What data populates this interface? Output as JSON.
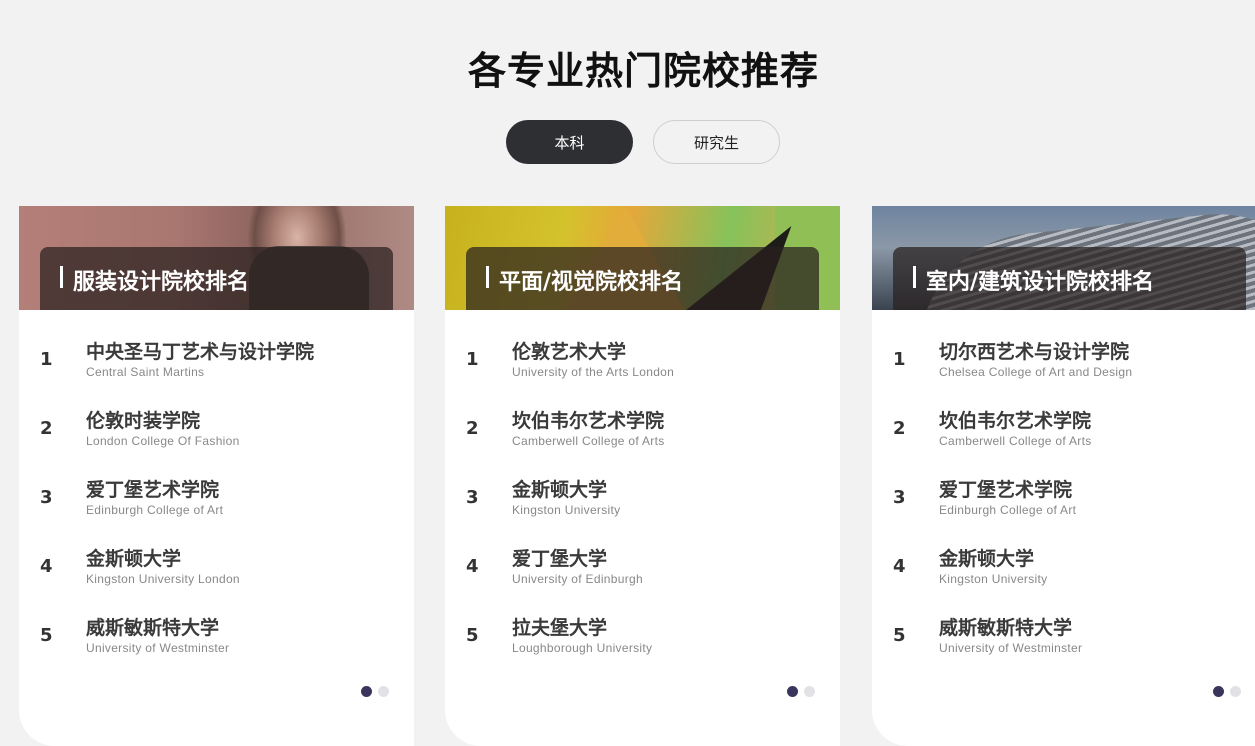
{
  "page_title": "各专业热门院校推荐",
  "tabs": [
    {
      "label": "本科",
      "active": true
    },
    {
      "label": "研究生",
      "active": false
    }
  ],
  "colors": {
    "accent_dark": "#2e2f33",
    "dot_active": "#3a355c",
    "dot_inactive": "#e2e2e6",
    "background": "#f2f2f2"
  },
  "cards": [
    {
      "title": "服装设计院校排名",
      "items": [
        {
          "rank": "1",
          "zh": "中央圣马丁艺术与设计学院",
          "en": "Central Saint Martins"
        },
        {
          "rank": "2",
          "zh": "伦敦时装学院",
          "en": "London College Of Fashion"
        },
        {
          "rank": "3",
          "zh": "爱丁堡艺术学院",
          "en": "Edinburgh College of Art"
        },
        {
          "rank": "4",
          "zh": "金斯顿大学",
          "en": "Kingston University London"
        },
        {
          "rank": "5",
          "zh": "威斯敏斯特大学",
          "en": "University of Westminster"
        }
      ]
    },
    {
      "title": "平面/视觉院校排名",
      "items": [
        {
          "rank": "1",
          "zh": "伦敦艺术大学",
          "en": "University of the Arts London"
        },
        {
          "rank": "2",
          "zh": "坎伯韦尔艺术学院",
          "en": "Camberwell College of Arts"
        },
        {
          "rank": "3",
          "zh": "金斯顿大学",
          "en": "Kingston University"
        },
        {
          "rank": "4",
          "zh": "爱丁堡大学",
          "en": "University of Edinburgh"
        },
        {
          "rank": "5",
          "zh": "拉夫堡大学",
          "en": "Loughborough University"
        }
      ]
    },
    {
      "title": "室内/建筑设计院校排名",
      "items": [
        {
          "rank": "1",
          "zh": "切尔西艺术与设计学院",
          "en": "Chelsea College of Art and Design"
        },
        {
          "rank": "2",
          "zh": "坎伯韦尔艺术学院",
          "en": "Camberwell College of Arts"
        },
        {
          "rank": "3",
          "zh": "爱丁堡艺术学院",
          "en": "Edinburgh College of Art"
        },
        {
          "rank": "4",
          "zh": "金斯顿大学",
          "en": "Kingston University"
        },
        {
          "rank": "5",
          "zh": "威斯敏斯特大学",
          "en": "University of Westminster"
        }
      ]
    }
  ]
}
